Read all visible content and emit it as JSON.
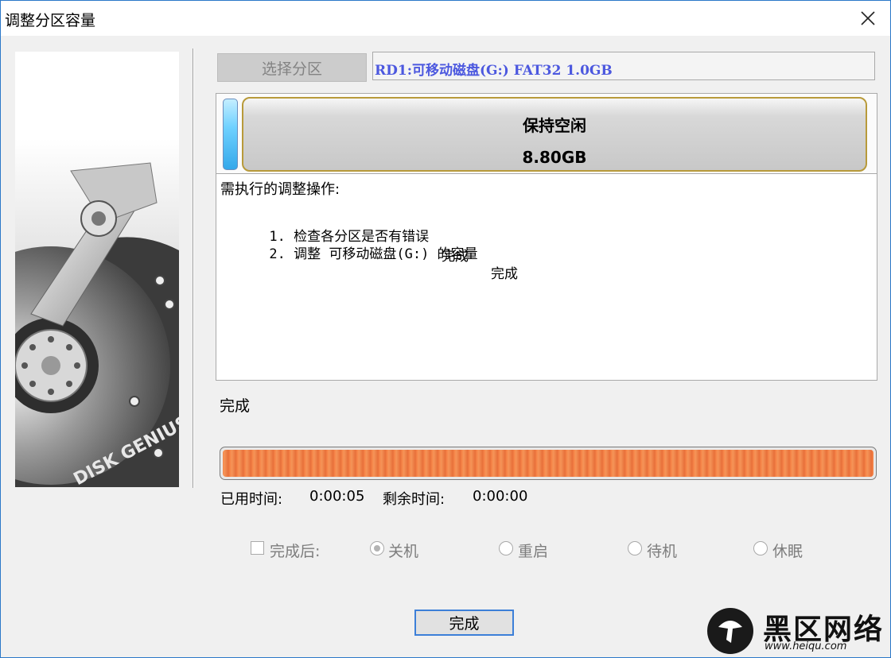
{
  "window": {
    "title": "调整分区容量"
  },
  "side_image": {
    "logo_text": "DISK GENIUS"
  },
  "partition": {
    "select_button_label": "选择分区",
    "selected_text": "RD1:可移动磁盘(G:) FAT32 1.0GB"
  },
  "disk_map": {
    "free_label": "保持空闲",
    "free_size": "8.80GB"
  },
  "operations": {
    "title": "需执行的调整操作:",
    "items": [
      {
        "text": "1. 检查各分区是否有错误",
        "status": "完成"
      },
      {
        "text": "2. 调整 可移动磁盘(G:) 的容量",
        "status": "完成"
      }
    ]
  },
  "status": {
    "text": "完成"
  },
  "progress": {
    "fraction": 1.0
  },
  "time": {
    "elapsed_label": "已用时间:",
    "elapsed_value": "0:00:05",
    "remaining_label": "剩余时间:",
    "remaining_value": "0:00:00"
  },
  "after_completion": {
    "checkbox_label": "完成后:",
    "checked": false,
    "options": [
      {
        "label": "关机",
        "selected": true
      },
      {
        "label": "重启",
        "selected": false
      },
      {
        "label": "待机",
        "selected": false
      },
      {
        "label": "休眠",
        "selected": false
      }
    ]
  },
  "done_button": {
    "label": "完成"
  },
  "watermark": {
    "title": "黑区网络",
    "url": "www.heiqu.com"
  },
  "colors": {
    "accent": "#3c7fd8",
    "partition_text": "#4c58df",
    "progress": "#f0833f",
    "disk_free_border": "#b89a3a"
  }
}
